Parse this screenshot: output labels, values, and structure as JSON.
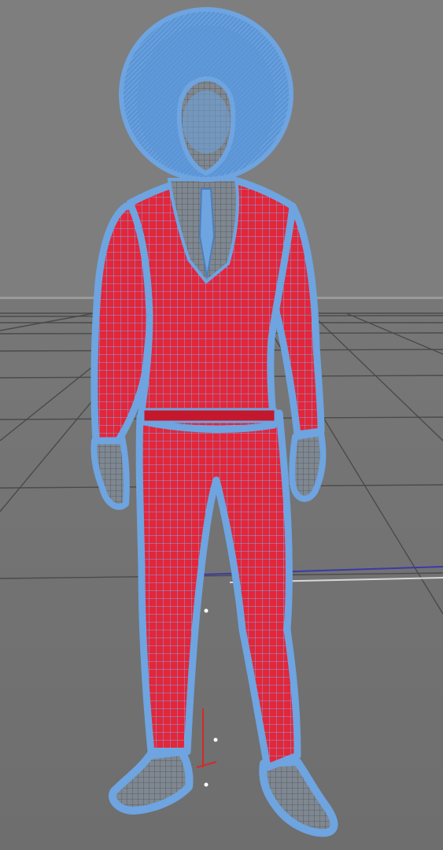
{
  "viewport": {
    "background_top": "#7c7c7c",
    "background_bottom": "#6e6e6e",
    "grid_color": "#4a4a4a",
    "horizon_color": "#9a9a9a"
  },
  "model": {
    "name": "character-wireframe",
    "hair_color": "#5b95d6",
    "wire_color": "#6ea4e0",
    "suit_color": "#e3263a",
    "suit_dark_color": "#b01426",
    "skin_wire_color": "#8a8f96",
    "shirt_color": "#9aa2aa"
  },
  "axes": {
    "x_color": "#d8d8d8",
    "y_color": "#d52a2a",
    "z_color": "#3a3aa8"
  }
}
